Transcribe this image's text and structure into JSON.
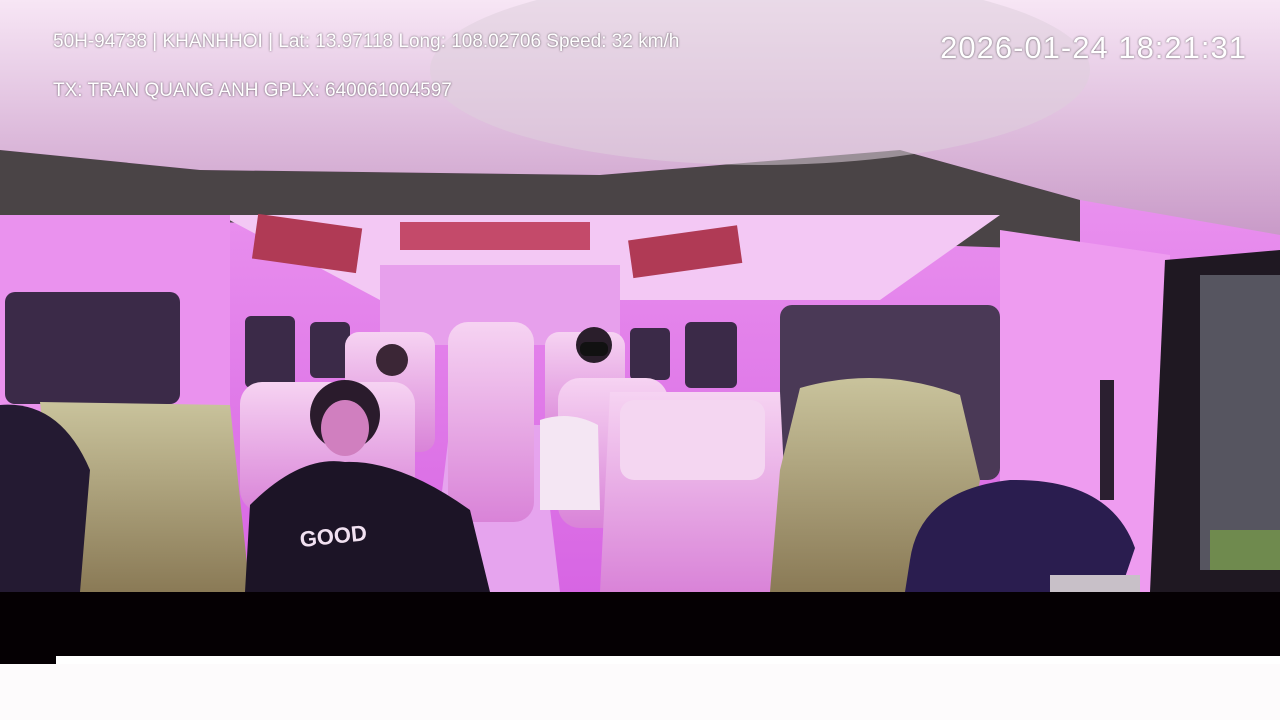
{
  "overlay": {
    "vehicle_info": "50H-94738 | KHANHHOI | Lat: 13.97118 Long: 108.02706 Speed: 32 km/h",
    "driver_info": "TX: TRAN QUANG ANH GPLX: 640061004597",
    "timestamp": "2026-01-24 18:21:31"
  },
  "scene": {
    "colors": {
      "interior": "#e98ef0",
      "ceiling": "#f3c6f4",
      "seat": "#f0b8ec",
      "dark": "#1a1030"
    }
  }
}
